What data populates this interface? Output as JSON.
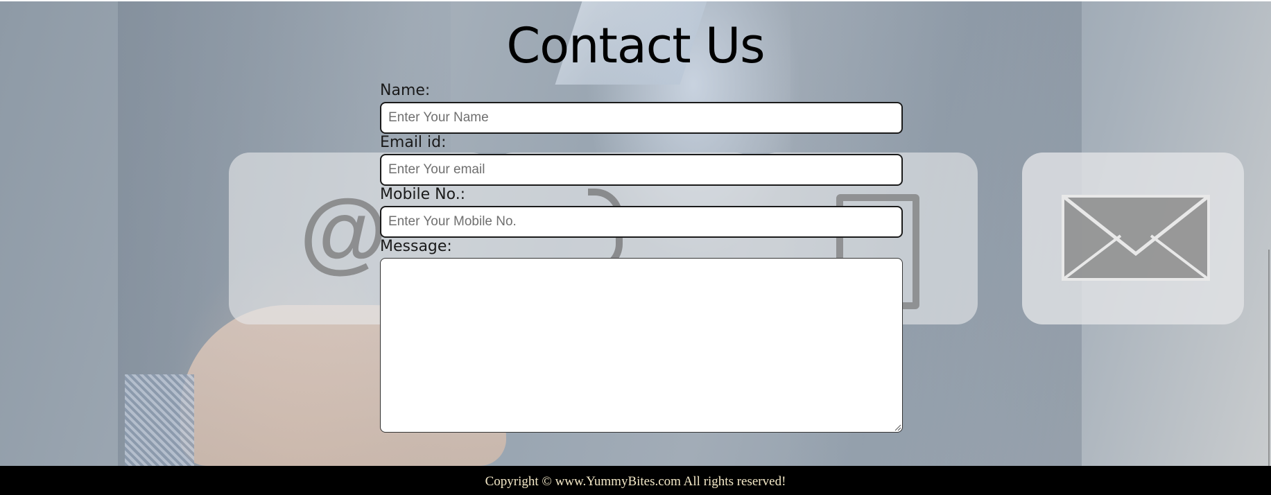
{
  "page": {
    "title": "Contact Us"
  },
  "form": {
    "name": {
      "label": "Name:",
      "placeholder": "Enter Your Name",
      "value": ""
    },
    "email": {
      "label": "Email id:",
      "placeholder": "Enter Your email",
      "value": ""
    },
    "mobile": {
      "label": "Mobile No.:",
      "placeholder": "Enter Your Mobile No.",
      "value": ""
    },
    "message": {
      "label": "Message:",
      "value": ""
    }
  },
  "background_icons": [
    "at-icon",
    "phone-icon",
    "mobile-phone-icon",
    "envelope-icon"
  ],
  "footer": {
    "text": "Copyright © www.YummyBites.com All rights reserved!"
  },
  "colors": {
    "footer_bg": "#000000",
    "footer_text": "#f4e9c8",
    "title": "#000000"
  }
}
